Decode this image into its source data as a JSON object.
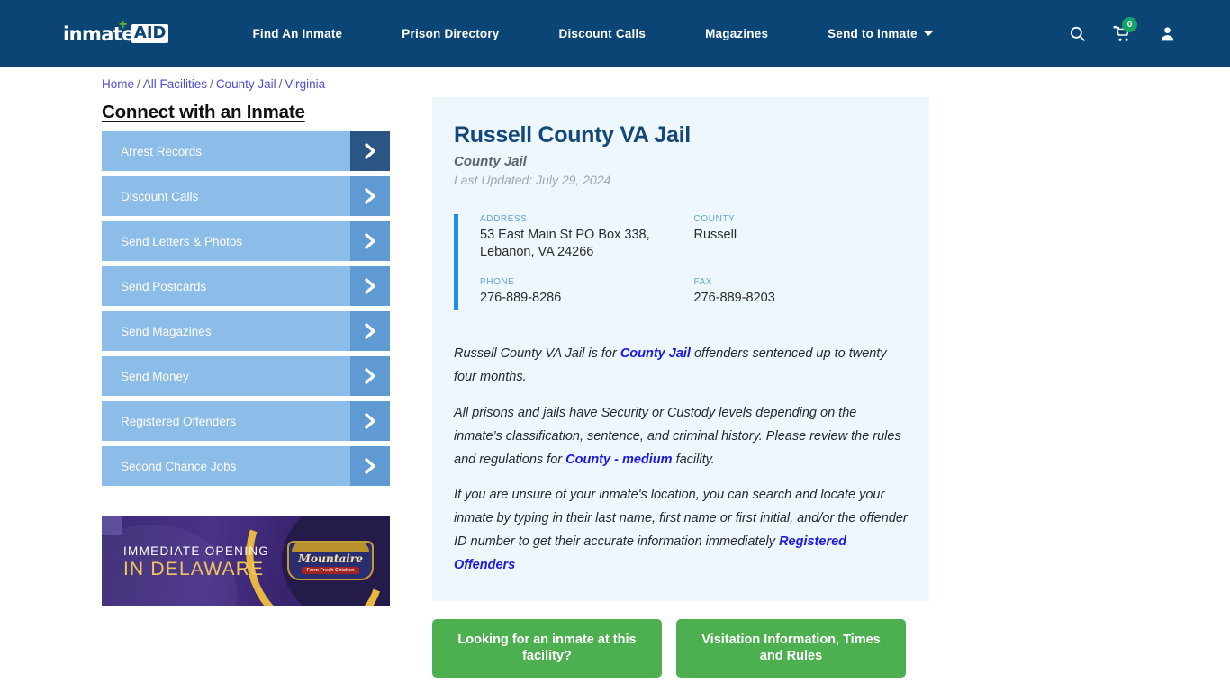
{
  "header": {
    "logo": {
      "text": "inmate",
      "badge": "AID",
      "cross": "+"
    },
    "nav": [
      {
        "label": "Find An Inmate"
      },
      {
        "label": "Prison Directory"
      },
      {
        "label": "Discount Calls"
      },
      {
        "label": "Magazines"
      },
      {
        "label": "Send to Inmate",
        "dropdown": true
      }
    ],
    "icons": {
      "search": "search-icon",
      "cart": "cart-icon",
      "cart_count": "0",
      "account": "user-icon"
    },
    "colors": {
      "background": "#0b4575",
      "badge_green": "#15a366"
    }
  },
  "breadcrumb": {
    "items": [
      "Home",
      "All Facilities",
      "County Jail",
      "Virginia"
    ],
    "separator": "/"
  },
  "sidebar": {
    "heading": "Connect with an Inmate",
    "items": [
      {
        "label": "Arrest Records",
        "active": true
      },
      {
        "label": "Discount Calls",
        "active": false
      },
      {
        "label": "Send Letters & Photos",
        "active": false
      },
      {
        "label": "Send Postcards",
        "active": false
      },
      {
        "label": "Send Magazines",
        "active": false
      },
      {
        "label": "Send Money",
        "active": false
      },
      {
        "label": "Registered Offenders",
        "active": false
      },
      {
        "label": "Second Chance Jobs",
        "active": false
      }
    ],
    "chevron_icon": "chevron-right-icon"
  },
  "ad": {
    "line1": "IMMEDIATE OPENING",
    "line2": "IN DELAWARE",
    "brand": "Mountaire",
    "brand_sub": "Farm Fresh Chicken",
    "accent": "#f0c659"
  },
  "facility": {
    "name": "Russell County VA Jail",
    "type": "County Jail",
    "last_updated": "Last Updated: July 29, 2024",
    "fields": [
      {
        "label": "ADDRESS",
        "value": "53 East Main St PO Box 338, Lebanon, VA 24266"
      },
      {
        "label": "COUNTY",
        "value": "Russell"
      },
      {
        "label": "PHONE",
        "value": "276-889-8286"
      },
      {
        "label": "FAX",
        "value": "276-889-8203"
      }
    ],
    "accent_bar_color": "#1e90e8"
  },
  "description": {
    "p1_a": "Russell County VA Jail is for ",
    "p1_link": "County Jail",
    "p1_b": " offenders sentenced up to twenty four months.",
    "p2_a": "All prisons and jails have Security or Custody levels depending on the inmate’s classification, sentence, and criminal history. Please review the rules and regulations for ",
    "p2_link": "County - medium",
    "p2_b": " facility.",
    "p3_a": "If you are unsure of your inmate's location, you can search and locate your inmate by typing in their last name, first name or first initial, and/or the offender ID number to get their accurate information immediately ",
    "p3_link": "Registered Offenders"
  },
  "cta": {
    "primary": "Looking for an inmate at this facility?",
    "secondary": "Visitation Information, Times and Rules",
    "color": "#4caf50"
  }
}
